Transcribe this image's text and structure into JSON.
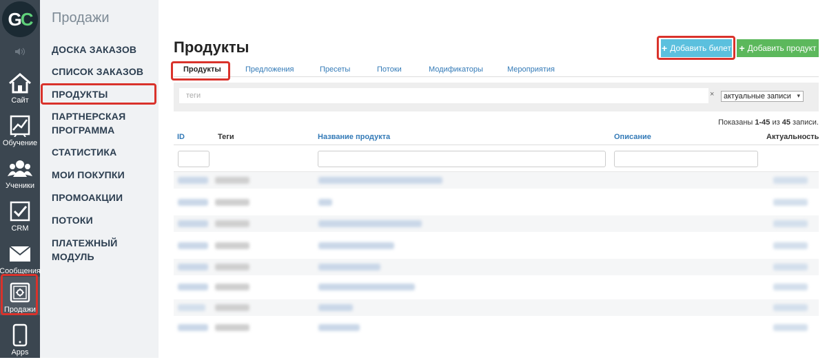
{
  "rail": {
    "logo": {
      "g": "G",
      "c": "C"
    },
    "items": [
      {
        "label": "Сайт",
        "icon": "home-icon"
      },
      {
        "label": "Обучение",
        "icon": "chart-icon"
      },
      {
        "label": "Ученики",
        "icon": "users-icon"
      },
      {
        "label": "CRM",
        "icon": "checkbox-icon"
      },
      {
        "label": "Сообщения",
        "icon": "envelope-icon"
      },
      {
        "label": "Продажи",
        "icon": "safe-icon"
      },
      {
        "label": "Apps",
        "icon": "phone-icon"
      }
    ]
  },
  "menu": {
    "title": "Продажи",
    "items": [
      {
        "label": "ДОСКА ЗАКАЗОВ"
      },
      {
        "label": "СПИСОК ЗАКАЗОВ"
      },
      {
        "label": "ПРОДУКТЫ"
      },
      {
        "label": "ПАРТНЕРСКАЯ ПРОГРАММА"
      },
      {
        "label": "СТАТИСТИКА"
      },
      {
        "label": "МОИ ПОКУПКИ"
      },
      {
        "label": "ПРОМОАКЦИИ"
      },
      {
        "label": "ПОТОКИ"
      },
      {
        "label": "ПЛАТЕЖНЫЙ МОДУЛЬ"
      }
    ]
  },
  "page": {
    "title": "Продукты",
    "add_ticket": "Добавить билет",
    "add_product": "Добавить продукт"
  },
  "tabs": [
    {
      "label": "Продукты"
    },
    {
      "label": "Предложения"
    },
    {
      "label": "Пресеты"
    },
    {
      "label": "Потоки"
    },
    {
      "label": "Модификаторы"
    },
    {
      "label": "Мероприятия"
    }
  ],
  "filter": {
    "tags_placeholder": "теги",
    "clear": "×",
    "status_selected": "актуальные записи"
  },
  "summary": {
    "prefix": "Показаны ",
    "range": "1-45",
    "mid": " из ",
    "total": "45",
    "suffix": " записи."
  },
  "table": {
    "headers": {
      "id": "ID",
      "tags": "Теги",
      "name": "Название продукта",
      "description": "Описание",
      "actual": "Актуальность"
    }
  },
  "colors": {
    "accent_link": "#337ab7",
    "highlight": "#d9322b",
    "btn_ticket": "#5bc0de",
    "btn_product": "#5cb85c"
  }
}
